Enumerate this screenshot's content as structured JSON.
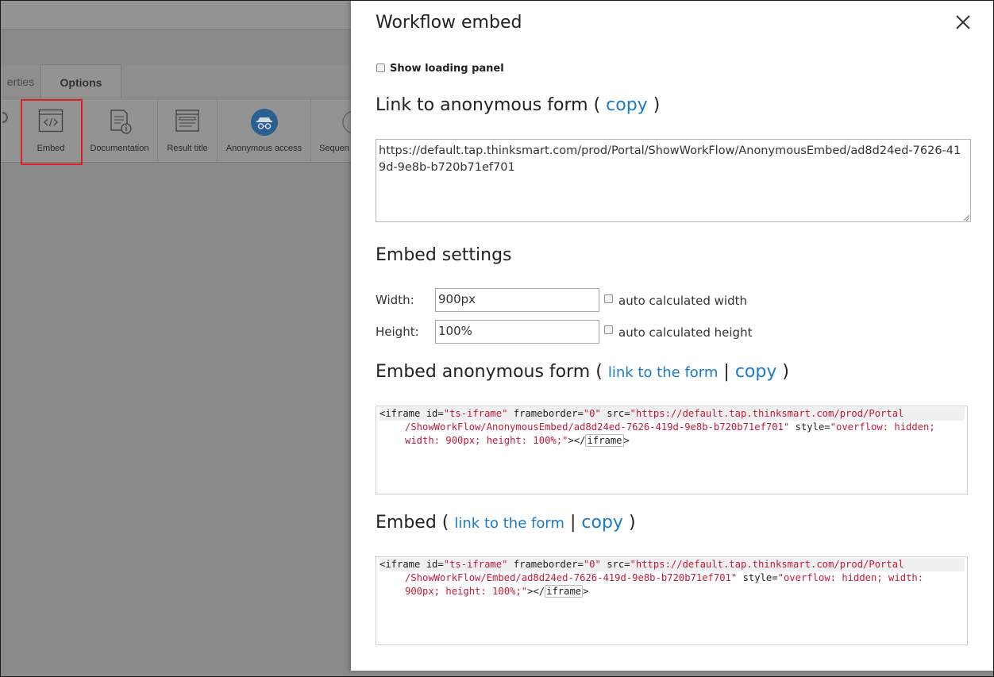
{
  "background": {
    "tabs": {
      "properties_partial": "erties",
      "options": "Options"
    },
    "tools": [
      {
        "label": "Embed"
      },
      {
        "label": "Documentation"
      },
      {
        "label": "Result title"
      },
      {
        "label": "Anonymous access"
      },
      {
        "label": "Sequen"
      }
    ]
  },
  "modal": {
    "title": "Workflow embed",
    "show_loading_label": "Show loading panel",
    "link_section": {
      "heading": "Link to anonymous form",
      "copy": "copy",
      "url": "https://default.tap.thinksmart.com/prod/Portal/ShowWorkFlow/AnonymousEmbed/ad8d24ed-7626-419d-9e8b-b720b71ef701"
    },
    "embed_settings": {
      "heading": "Embed settings",
      "width_label": "Width:",
      "width_value": "900px",
      "auto_width_label": "auto calculated width",
      "height_label": "Height:",
      "height_value": "100%",
      "auto_height_label": "auto calculated height"
    },
    "embed_anon": {
      "heading": "Embed anonymous form",
      "link": "link to the form",
      "sep": "|",
      "copy": "copy",
      "code": {
        "open": "<iframe",
        "id_attr": " id=",
        "id_val": "\"ts-iframe\"",
        "fb_attr": " frameborder=",
        "fb_val": "\"0\"",
        "src_attr": " src=",
        "src_val_1": "\"https://default.tap.thinksmart.com/prod/Portal",
        "src_val_2": "/ShowWorkFlow/AnonymousEmbed/ad8d24ed-7626-419d-9e8b-b720b71ef701\"",
        "style_attr": " style=",
        "style_val_1": "\"overflow: hidden;",
        "style_val_2": "width: 900px; height: 100%;\"",
        "close_1": "></",
        "close_tag": "iframe",
        "close_2": ">"
      }
    },
    "embed": {
      "heading": "Embed",
      "link": "link to the form",
      "sep": "|",
      "copy": "copy",
      "code": {
        "open": "<iframe",
        "id_attr": " id=",
        "id_val": "\"ts-iframe\"",
        "fb_attr": " frameborder=",
        "fb_val": "\"0\"",
        "src_attr": " src=",
        "src_val_1": "\"https://default.tap.thinksmart.com/prod/Portal",
        "src_val_2": "/ShowWorkFlow/Embed/ad8d24ed-7626-419d-9e8b-b720b71ef701\"",
        "style_attr": " style=",
        "style_val_1": "\"overflow: hidden; width:",
        "style_val_2": "900px; height: 100%;\"",
        "close_1": "></",
        "close_tag": "iframe",
        "close_2": ">"
      }
    }
  }
}
